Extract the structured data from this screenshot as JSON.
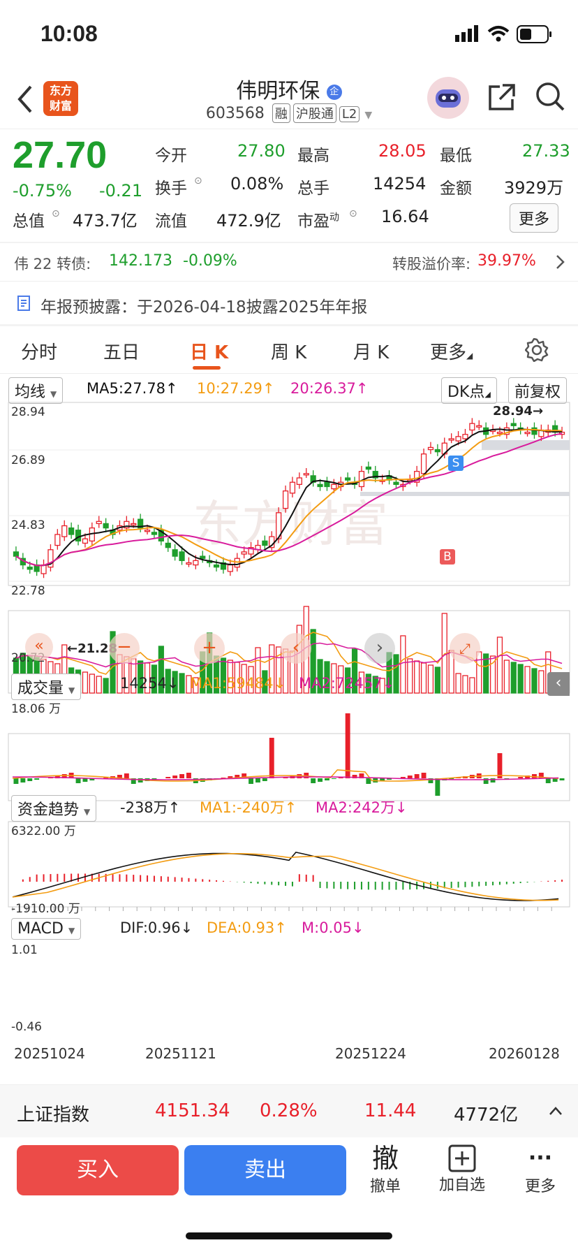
{
  "status_bar": {
    "time": "10:08"
  },
  "header": {
    "logo_text": "东方\n财富",
    "stock_name": "伟明环保",
    "name_badge": "企",
    "stock_code": "603568",
    "tags": [
      "融",
      "沪股通",
      "L2"
    ]
  },
  "quote": {
    "price": "27.70",
    "change_pct": "-0.75%",
    "change_abs": "-0.21",
    "open_label": "今开",
    "open_value": "27.80",
    "high_label": "最高",
    "high_value": "28.05",
    "low_label": "最低",
    "low_value": "27.33",
    "turnover_label": "换手",
    "turnover_value": "0.08%",
    "volume_label": "总手",
    "volume_value": "14254",
    "amount_label": "金额",
    "amount_value": "3929万",
    "mktcap_label": "总值",
    "mktcap_value": "473.7亿",
    "float_label": "流值",
    "float_value": "472.9亿",
    "pe_label": "市盈",
    "pe_sup": "动",
    "pe_value": "16.64",
    "more_label": "更多"
  },
  "convertible": {
    "label": "伟 22 转债:",
    "price": "142.173",
    "change": "-0.09%",
    "premium_label": "转股溢价率:",
    "premium_value": "39.97%"
  },
  "notice": {
    "text": "年报预披露：于2026-04-18披露2025年年报"
  },
  "tabs": [
    {
      "label": "分时"
    },
    {
      "label": "五日"
    },
    {
      "label": "日 K"
    },
    {
      "label": "周 K"
    },
    {
      "label": "月 K"
    },
    {
      "label": "更多"
    }
  ],
  "kline_panel": {
    "indicator": "均线",
    "ma5": "MA5:27.78",
    "ma10": "10:27.29",
    "ma20": "20:26.37",
    "dk_label": "DK点",
    "adjust_label": "前复权",
    "y_ticks": [
      "28.94",
      "26.89",
      "24.83",
      "22.78",
      "20.72"
    ],
    "high_mark": "28.94",
    "low_mark": "21.28",
    "watermark": "东方财富",
    "signal_s": "S",
    "signal_b": "B"
  },
  "volume_panel": {
    "indicator": "成交量",
    "value": "14254",
    "ma1": "MA1:59484",
    "ma2": "MA2:72457",
    "y_top": "18.06 万"
  },
  "fund_panel": {
    "indicator": "资金趋势",
    "value": "-238万",
    "ma1": "MA1:-240万",
    "ma2": "MA2:242万",
    "y_top": "6322.00 万",
    "y_bottom": "-1910.00 万"
  },
  "macd_panel": {
    "indicator": "MACD",
    "dif": "DIF:0.96",
    "dea": "DEA:0.93",
    "m": "M:0.05",
    "y_top": "1.01",
    "y_bottom": "-0.46"
  },
  "x_dates": [
    "20251024",
    "20251121",
    "20251224",
    "20260128"
  ],
  "index_bar": {
    "name": "上证指数",
    "value": "4151.34",
    "pct": "0.28%",
    "change": "11.44",
    "amount": "4772亿"
  },
  "bottom_bar": {
    "buy": "买入",
    "sell": "卖出",
    "withdraw_glyph": "撤",
    "withdraw": "撤单",
    "add_fav": "加自选",
    "more": "更多"
  },
  "colors": {
    "up": "#e8202a",
    "down": "#1e9e2c",
    "ma5": "#111111",
    "ma10": "#f39c12",
    "ma20": "#d81b9c",
    "accent": "#e8541c"
  }
}
